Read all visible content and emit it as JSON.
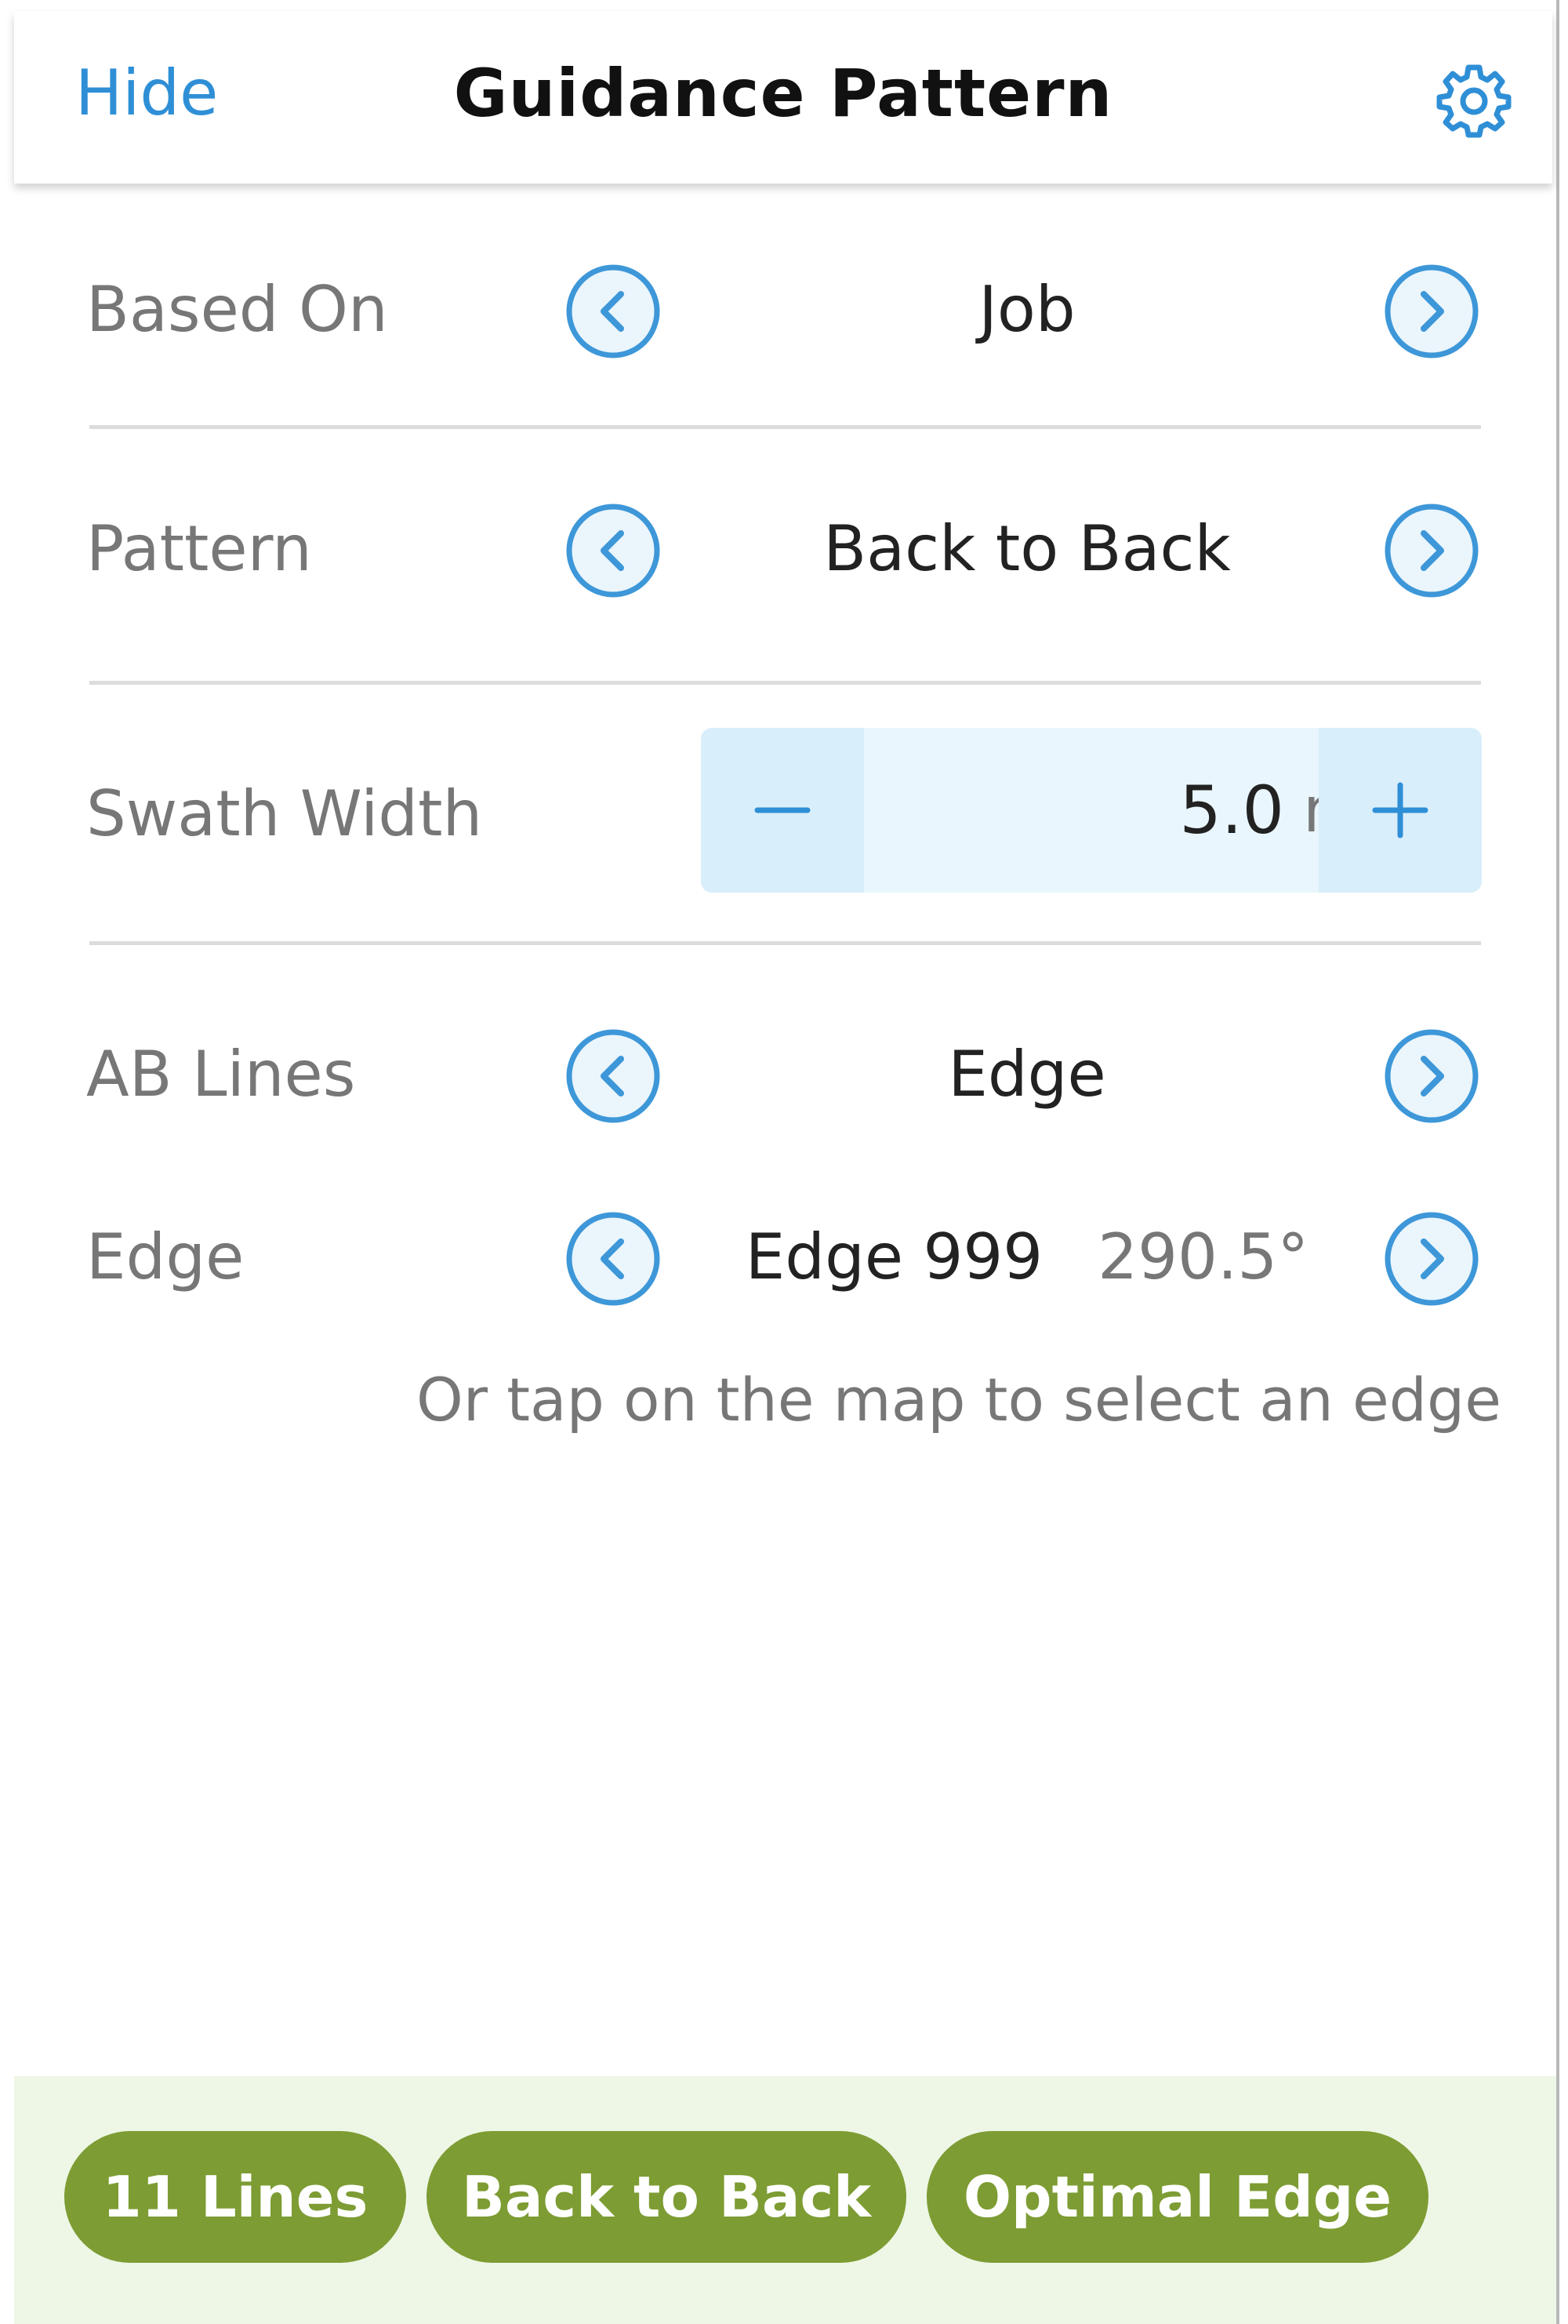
{
  "header": {
    "hide_label": "Hide",
    "title": "Guidance Pattern",
    "settings_icon": "gear-icon"
  },
  "rows": {
    "based_on": {
      "label": "Based On",
      "value": "Job"
    },
    "pattern": {
      "label": "Pattern",
      "value": "Back to Back"
    },
    "swath_width": {
      "label": "Swath Width",
      "value": "5.0",
      "unit": "m",
      "minus": "−",
      "plus": "+"
    },
    "ab_lines": {
      "label": "AB Lines",
      "value": "Edge"
    },
    "edge": {
      "label": "Edge",
      "value": "Edge 999",
      "angle": "290.5°"
    }
  },
  "hint": "Or tap on the map to select an edge",
  "footer": {
    "buttons": [
      "11 Lines",
      "Back to Back",
      "Optimal Edge"
    ]
  },
  "colors": {
    "accent_blue": "#2f8fd6",
    "green_pill": "#7d9c33",
    "footer_bg": "#eef7e6",
    "stepper_bg": "#e9f6fd"
  }
}
